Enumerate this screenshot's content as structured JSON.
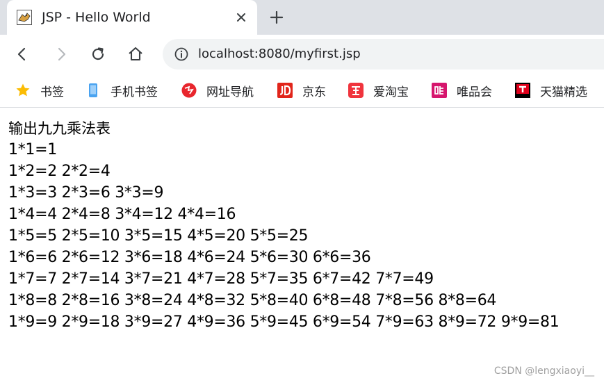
{
  "tab": {
    "title": "JSP - Hello World"
  },
  "address_bar": {
    "url": "localhost:8080/myfirst.jsp"
  },
  "bookmarks": [
    {
      "label": "书签",
      "icon": "star-icon",
      "color": "#fbbc04"
    },
    {
      "label": "手机书签",
      "icon": "phone-icon",
      "color": "#4aa3f0"
    },
    {
      "label": "网址导航",
      "icon": "navigation-icon",
      "color": "#e8262d"
    },
    {
      "label": "京东",
      "icon": "jd-icon",
      "color": "#e1251b"
    },
    {
      "label": "爱淘宝",
      "icon": "taobao-icon",
      "color": "#f0343d"
    },
    {
      "label": "唯品会",
      "icon": "vip-icon",
      "color": "#d6166d"
    },
    {
      "label": "天猫精选",
      "icon": "tmall-icon",
      "color": "#e0001b"
    }
  ],
  "page": {
    "heading": "输出九九乘法表",
    "rows": [
      "1*1=1",
      "1*2=2 2*2=4",
      "1*3=3 2*3=6 3*3=9",
      "1*4=4 2*4=8 3*4=12 4*4=16",
      "1*5=5 2*5=10 3*5=15 4*5=20 5*5=25",
      "1*6=6 2*6=12 3*6=18 4*6=24 5*6=30 6*6=36",
      "1*7=7 2*7=14 3*7=21 4*7=28 5*7=35 6*7=42 7*7=49",
      "1*8=8 2*8=16 3*8=24 4*8=32 5*8=40 6*8=48 7*8=56 8*8=64",
      "1*9=9 2*9=18 3*9=27 4*9=36 5*9=45 6*9=54 7*9=63 8*9=72 9*9=81"
    ]
  },
  "watermark": "CSDN @lengxiaoyi__"
}
